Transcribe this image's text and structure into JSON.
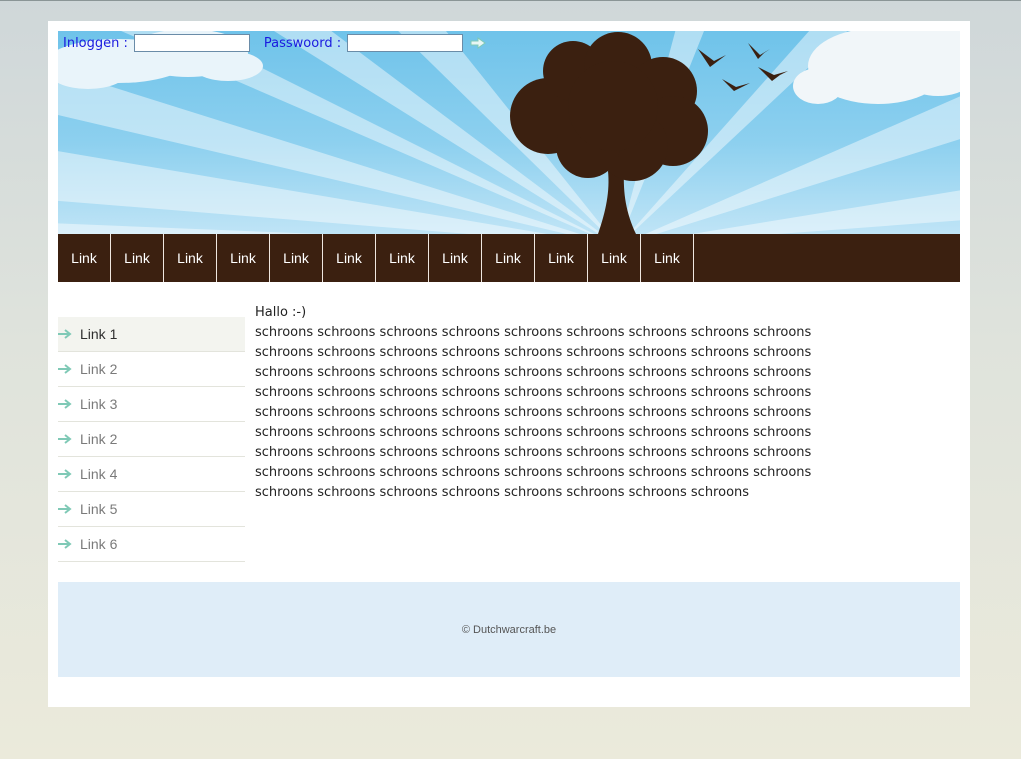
{
  "login": {
    "username_label": "Inloggen :",
    "username_value": "",
    "password_label": "Passwoord :",
    "password_value": "",
    "submit_icon": "arrow-right-icon"
  },
  "nav": {
    "items": [
      "Link",
      "Link",
      "Link",
      "Link",
      "Link",
      "Link",
      "Link",
      "Link",
      "Link",
      "Link",
      "Link",
      "Link"
    ]
  },
  "sidebar": {
    "active_index": 0,
    "items": [
      "Link 1",
      "Link 2",
      "Link 3",
      "Link 2",
      "Link 4",
      "Link 5",
      "Link 6"
    ]
  },
  "content": {
    "greeting": "Hallo :-)",
    "text": "schroons schroons schroons schroons schroons schroons schroons schroons schroons schroons schroons schroons schroons schroons schroons schroons schroons schroons schroons schroons schroons schroons schroons schroons schroons schroons schroons schroons schroons schroons schroons schroons schroons schroons schroons schroons schroons schroons schroons schroons schroons schroons schroons schroons schroons schroons schroons schroons schroons schroons schroons schroons schroons schroons schroons schroons schroons schroons schroons schroons schroons schroons schroons schroons schroons schroons schroons schroons schroons schroons schroons schroons schroons schroons schroons schroons schroons schroons schroons schroons"
  },
  "footer": {
    "copyright": "© Dutchwarcraft.be"
  },
  "colors": {
    "nav_bg": "#3b2010",
    "footer_bg": "#dfedf8",
    "sky": "#6fc3ea",
    "arrow": "#7fc9b6"
  }
}
